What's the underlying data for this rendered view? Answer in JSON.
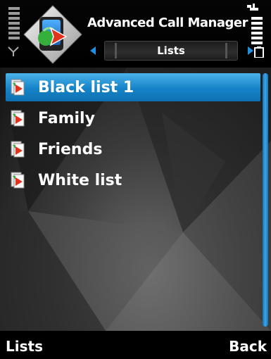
{
  "header": {
    "app_title": "Advanced Call Manager",
    "tab_label": "Lists"
  },
  "lists": {
    "items": [
      {
        "label": "Black list 1",
        "selected": true
      },
      {
        "label": "Family",
        "selected": false
      },
      {
        "label": "Friends",
        "selected": false
      },
      {
        "label": "White list",
        "selected": false
      }
    ]
  },
  "softkeys": {
    "left": "Lists",
    "right": "Back"
  },
  "colors": {
    "accent": "#1583c8",
    "highlight": "#4ab3ea",
    "text": "#ffffff",
    "background": "#111111"
  },
  "icons": {
    "app": "call-manager-app-icon",
    "list_item": "list-document-icon",
    "signal": "signal-strength-icon",
    "battery": "battery-icon"
  }
}
